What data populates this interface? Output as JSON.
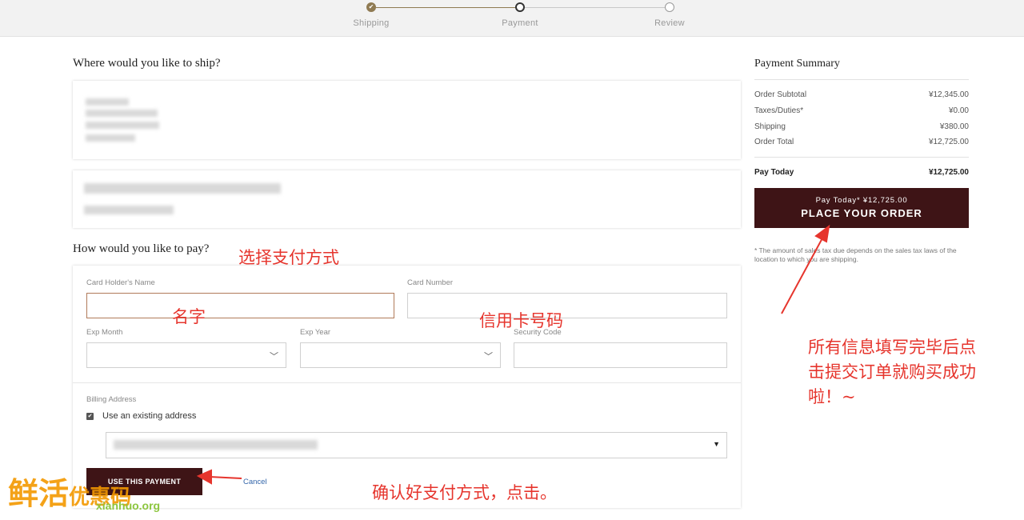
{
  "steps": [
    {
      "label": "Shipping",
      "state": "done"
    },
    {
      "label": "Payment",
      "state": "active"
    },
    {
      "label": "Review",
      "state": "pending"
    }
  ],
  "shipping": {
    "heading": "Where would you like to ship?"
  },
  "payment": {
    "heading": "How would you like to pay?",
    "card_holder_label": "Card Holder's Name",
    "card_holder_value": "",
    "card_number_label": "Card Number",
    "card_number_value": "",
    "exp_month_label": "Exp Month",
    "exp_year_label": "Exp Year",
    "security_code_label": "Security Code",
    "billing_label": "Billing Address",
    "use_existing_label": "Use an existing address",
    "use_payment_button": "USE THIS PAYMENT",
    "cancel_link": "Cancel"
  },
  "summary": {
    "title": "Payment Summary",
    "rows": [
      {
        "label": "Order Subtotal",
        "value": "¥12,345.00"
      },
      {
        "label": "Taxes/Duties*",
        "value": "¥0.00"
      },
      {
        "label": "Shipping",
        "value": "¥380.00"
      },
      {
        "label": "Order Total",
        "value": "¥12,725.00"
      }
    ],
    "pay_today_label": "Pay Today",
    "pay_today_value": "¥12,725.00",
    "button_small": "Pay Today* ¥12,725.00",
    "button_big": "PLACE YOUR ORDER",
    "footnote": "* The amount of sales tax due depends on the sales tax laws of the location to which you are shipping."
  },
  "annotations": {
    "choose_payment": "选择支付方式",
    "name": "名字",
    "card_number": "信用卡号码",
    "confirm_payment": "确认好支付方式，点击。",
    "final_line1": "所有信息填写完毕后点",
    "final_line2": "击提交订单就购买成功",
    "final_line3": "啦！~"
  },
  "watermark": {
    "brand": "鲜活优惠码",
    "url": "xianhuo.org"
  },
  "colors": {
    "accent": "#3e1416",
    "step_done": "#8f7a52",
    "annotation": "#e6352d",
    "watermark_green": "#8dc63f",
    "watermark_orange": "#f39800"
  }
}
